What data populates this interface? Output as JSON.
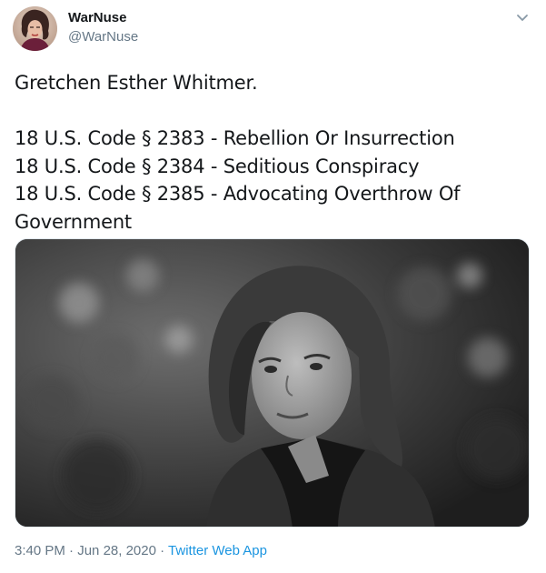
{
  "author": {
    "name": "WarNuse",
    "handle": "@WarNuse"
  },
  "icons": {
    "menu": "chevron-down-icon"
  },
  "tweet": {
    "lines": [
      "Gretchen Esther Whitmer.",
      "18 U.S. Code § 2383 - Rebellion Or Insurrection",
      "18 U.S. Code § 2384 - Seditious Conspiracy",
      "18 U.S. Code § 2385 - Advocating Overthrow Of",
      "Government"
    ]
  },
  "meta": {
    "time": "3:40 PM",
    "date": "Jun 28, 2020",
    "separator": "·",
    "source": "Twitter Web App"
  },
  "colors": {
    "text": "#14171a",
    "secondary": "#657786",
    "link": "#1b95e0"
  }
}
